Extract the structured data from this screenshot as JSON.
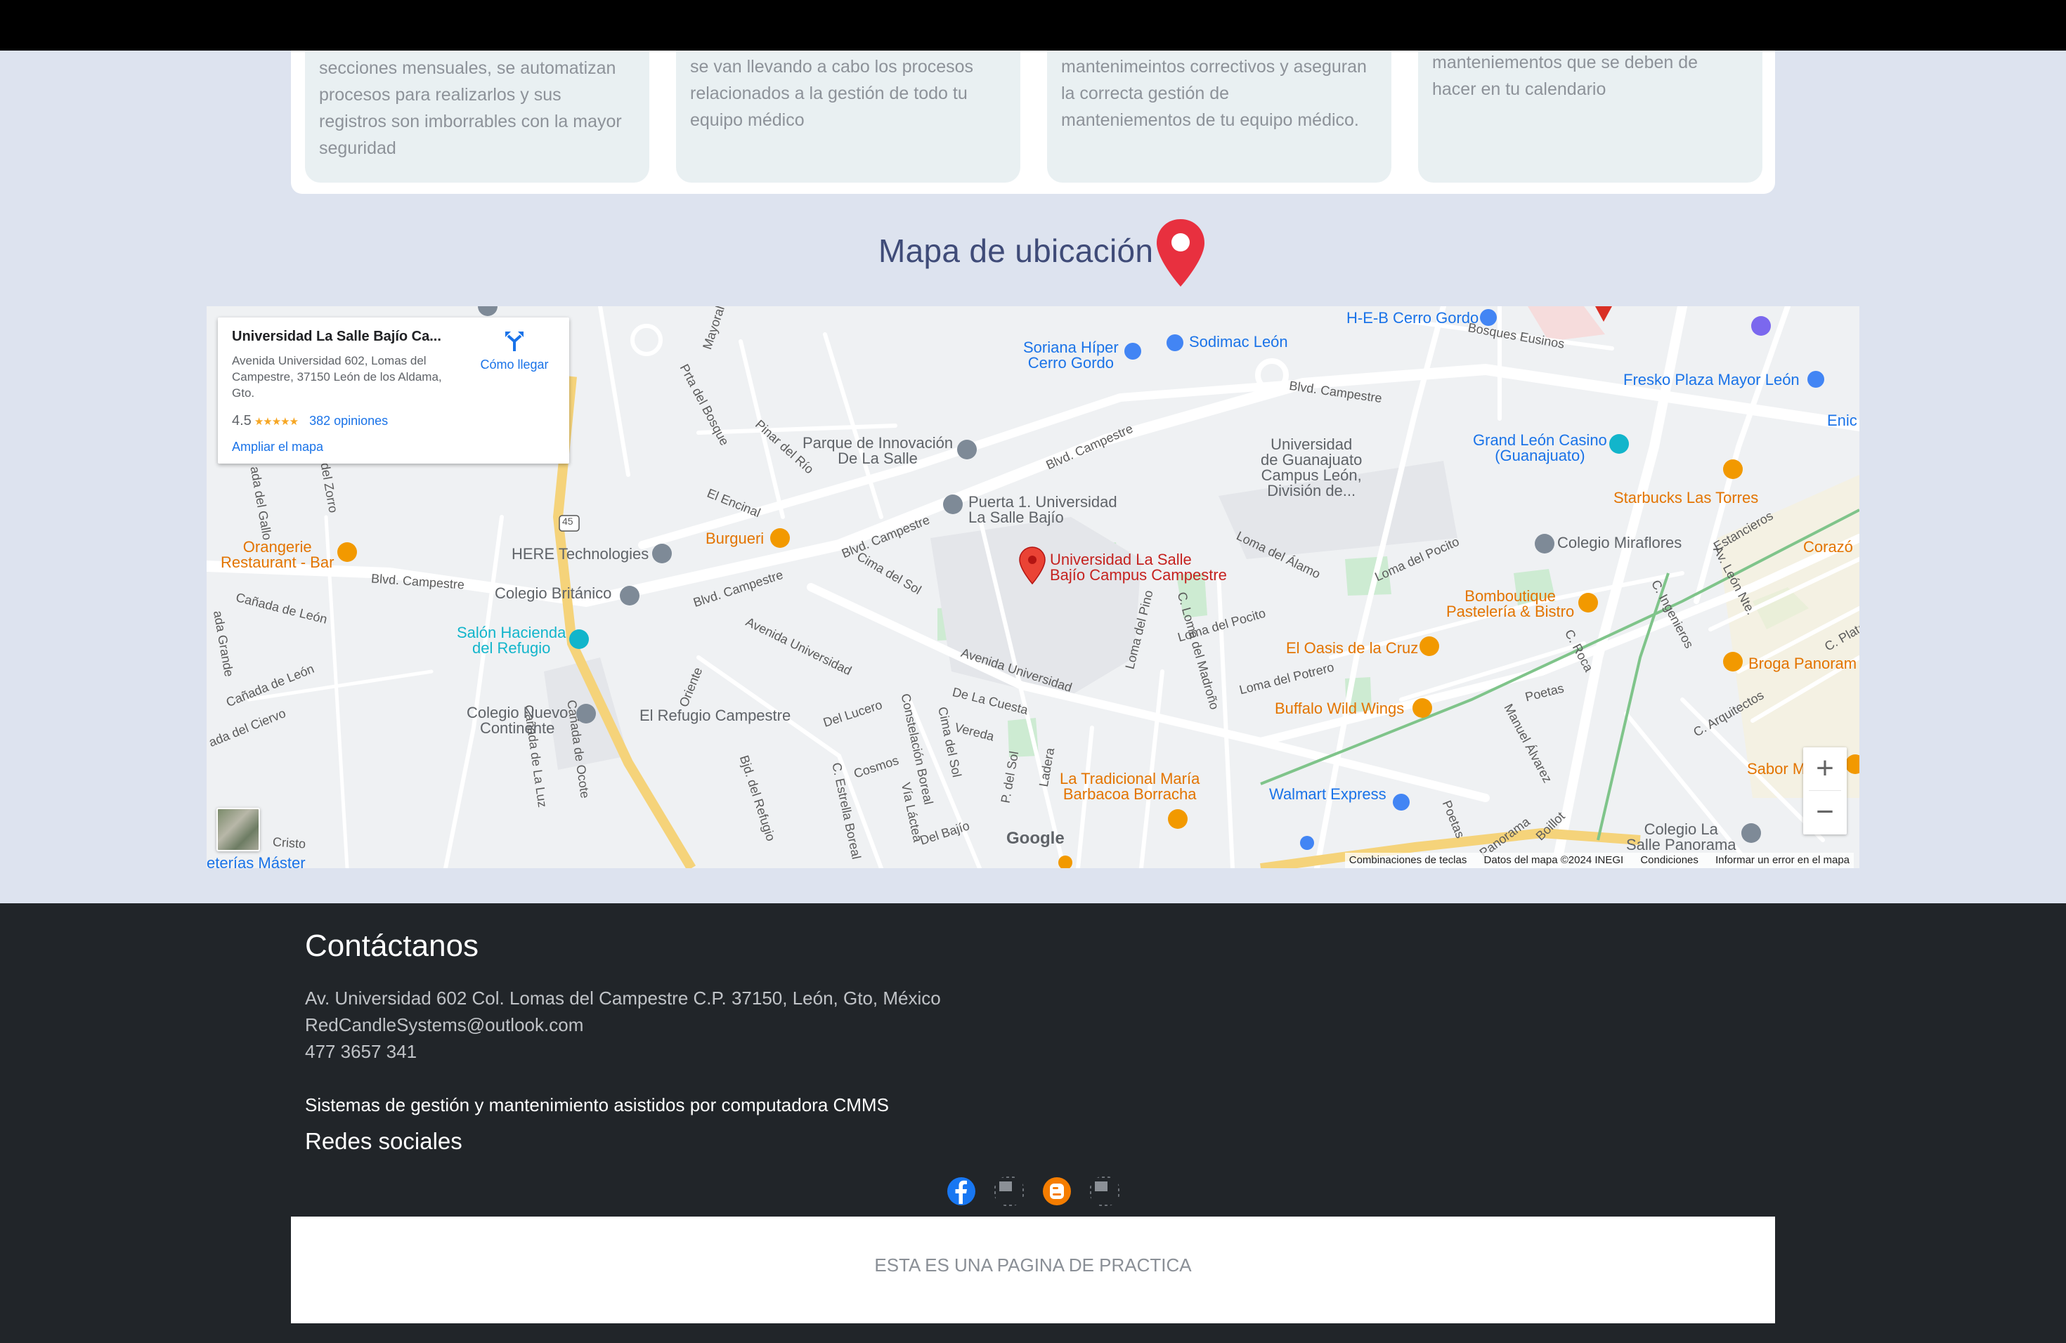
{
  "cards": [
    {
      "text_lines": [
        "secciones mensuales, se automatizan",
        "procesos para realizarlos y sus",
        "registros son imborrables con la mayor",
        "seguridad"
      ]
    },
    {
      "text_lines": [
        "se van llevando a cabo los procesos",
        "relacionados a la gestión de todo tu",
        "equipo médico"
      ]
    },
    {
      "text_lines": [
        "mantenimeintos correctivos y aseguran",
        "la correcta gestión de",
        "manteniementos de tu equipo médico."
      ]
    },
    {
      "text_lines": [
        "manteniementos que se deben de",
        "hacer en tu calendario"
      ]
    }
  ],
  "map_section": {
    "title": "Mapa de ubicación",
    "pin_color": "#e8303f"
  },
  "map": {
    "infobox": {
      "title": "Universidad La Salle Bajío Ca...",
      "address": "Avenida Universidad 602, Lomas del Campestre, 37150 León de los Aldama, Gto.",
      "rating": "4.5",
      "stars": "★★★★★",
      "reviews": "382 opiniones",
      "larger_map": "Ampliar el mapa",
      "directions": "Cómo llegar"
    },
    "marker_label_1": "Universidad La Salle",
    "marker_label_2": "Bajío Campus Campestre",
    "places": {
      "soriana_1": "Soriana Híper",
      "soriana_2": "Cerro Gordo",
      "sodimac": "Sodimac León",
      "heb": "H-E-B Cerro Gordo",
      "fresko": "Fresko Plaza Mayor León",
      "parque_1": "Parque de Innovación",
      "parque_2": "De La Salle",
      "puerta_1": "Puerta 1. Universidad",
      "puerta_2": "La Salle Bajío",
      "ug_1": "Universidad",
      "ug_2": "de Guanajuato",
      "ug_3": "Campus León,",
      "ug_4": "División de...",
      "grand_1": "Grand León Casino",
      "grand_2": "(Guanajuato)",
      "starbucks": "Starbucks Las Torres",
      "orangerie_1": "Orangerie",
      "orangerie_2": "Restaurant - Bar",
      "here": "HERE Technologies",
      "burgueri": "Burgueri",
      "britanico": "Colegio Británico",
      "salon_1": "Salón Hacienda",
      "salon_2": "del Refugio",
      "miraflores": "Colegio Miraflores",
      "bomb_1": "Bomboutique",
      "bomb_2": "Pastelería & Bistro",
      "oasis": "El Oasis de la Cruz",
      "broga": "Broga Panoram",
      "buffalo": "Buffalo Wild Wings",
      "nuevo_1": "Colegio Nuevo",
      "nuevo_2": "Continente",
      "refugio": "El Refugio Campestre",
      "tradicional_1": "La Tradicional María",
      "tradicional_2": "Barbacoa Borracha",
      "walmart": "Walmart Express",
      "sabor": "Sabor M",
      "panorama_1": "Colegio La",
      "panorama_2": "Salle Panorama",
      "corazon": "Corazó",
      "enic": "Enic",
      "masters": "eterías Máster"
    },
    "streets": {
      "blvd1": "Blvd. Campestre",
      "blvd2": "Blvd. Campestre",
      "blvd3": "Blvd. Campestre",
      "blvd4": "Blvd. Campestre",
      "blvd5": "Blvd. Campestre",
      "av_univ1": "Avenida Universidad",
      "av_univ2": "Avenida Universidad",
      "bosques": "Bosques Eusinos",
      "mayoral": "Mayoral",
      "prta_bosque": "Prta del Bosque",
      "pinar": "Pinar del Río",
      "encinal": "El Encinal",
      "cima_sol": "Cima del Sol",
      "canada_leon1": "Cañada de León",
      "canada_leon2": "Cañada de León",
      "loma_alamo": "Loma del Álamo",
      "loma_pocito1": "Loma del Pocito",
      "loma_pocito2": "Loma del Pocito",
      "loma_potrero": "Loma del Potrero",
      "loma_pino": "Loma del Pino",
      "loma_madrono": "C. Loma del Madroño",
      "de_la_cuesta": "De La Cuesta",
      "vereda": "Vereda",
      "del_lucero": "Del Lucero",
      "cosmos": "Cosmos",
      "del_bajio": "Del Bajío",
      "ladera": "Ladera",
      "constelacion": "Constelación Boreal",
      "estrella": "C. Estrella Boreal",
      "via_lactea": "Vía Láctea",
      "cima_sol2": "Cima del Sol",
      "p_sol": "P. del Sol",
      "oriente": "Oriente",
      "bjd_refugio": "Bjd. del Refugio",
      "estancieros": "Estancieros",
      "av_leon": "Av. León Nte.",
      "ingenieros": "C. Ingenieros",
      "arquitectos": "C. Arquitectos",
      "poetas": "Poetas",
      "poetas2": "Poetas",
      "c_roca": "C. Roca",
      "manuel_alvarez": "Manuel Álvarez",
      "boillot": "Boillot",
      "panorama_st": "Panorama",
      "cristo": "Cristo",
      "del_cierv": "ada del Ciervo",
      "canada_luz": "Cañada de La Luz",
      "canada_ocote": "Cañada de Ocote",
      "del_zorro": "del Zorro",
      "del_gallo": "ada del Gallo",
      "grande": "ada Grande",
      "c_plata": "C. Plata",
      "hwy45": "45"
    },
    "attribution": {
      "shortcuts": "Combinaciones de teclas",
      "data": "Datos del mapa ©2024 INEGI",
      "terms": "Condiciones",
      "report": "Informar un error en el mapa"
    },
    "google": "Google",
    "zoom_in": "+",
    "zoom_out": "−"
  },
  "footer": {
    "title": "Contáctanos",
    "address": "Av. Universidad 602 Col. Lomas del Campestre C.P. 37150, León, Gto, México",
    "email": "RedCandleSystems@outlook.com",
    "phone": "477 3657 341",
    "tagline": "Sistemas de gestión y mantenimiento asistidos por computadora CMMS",
    "social_title": "Redes sociales",
    "social_icons": [
      "facebook-icon",
      "twitter-icon",
      "blogger-icon",
      "instagram-icon"
    ],
    "notice": "ESTA ES UNA PAGINA DE PRACTICA"
  }
}
